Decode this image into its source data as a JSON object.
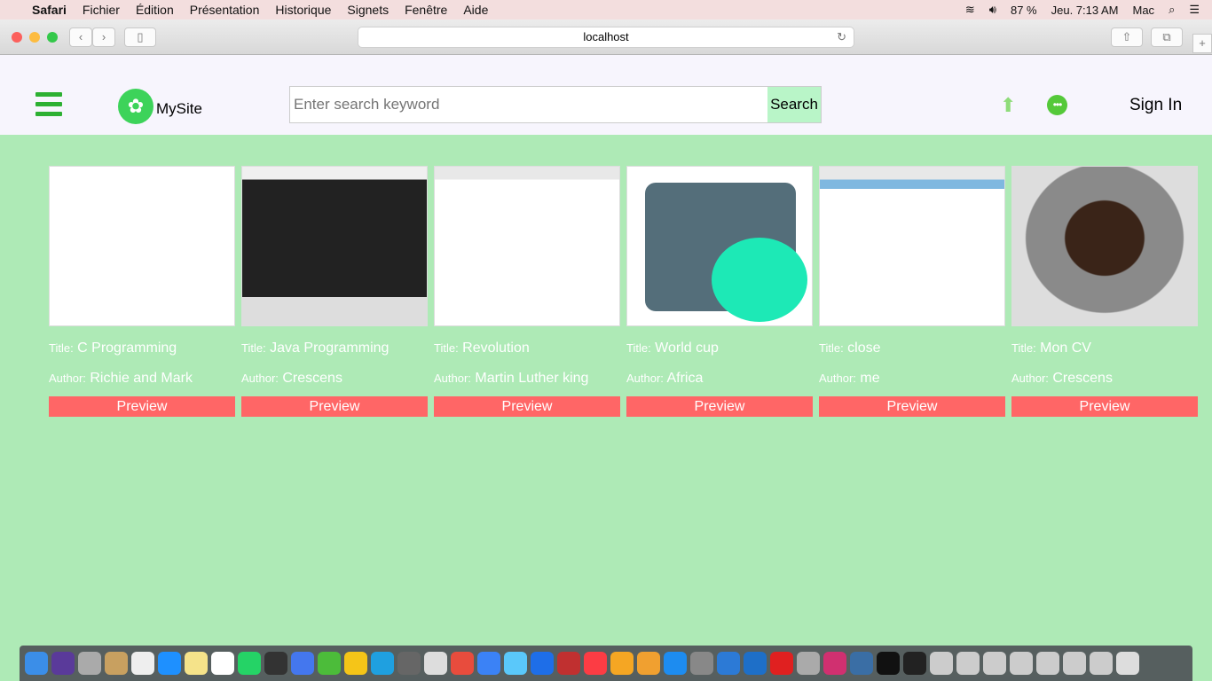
{
  "menubar": {
    "app": "Safari",
    "items": [
      "Fichier",
      "Édition",
      "Présentation",
      "Historique",
      "Signets",
      "Fenêtre",
      "Aide"
    ],
    "battery": "87 %",
    "clock": "Jeu. 7:13 AM",
    "user": "Mac"
  },
  "browser": {
    "url": "localhost"
  },
  "header": {
    "site_name": "MySite",
    "search_placeholder": "Enter search keyword",
    "search_button": "Search",
    "sign_in": "Sign In"
  },
  "labels": {
    "title": "Title:",
    "author": "Author:",
    "preview": "Preview"
  },
  "cards": [
    {
      "title": "C Programming",
      "author": "Richie and Mark"
    },
    {
      "title": "Java Programming",
      "author": "Crescens"
    },
    {
      "title": "Revolution",
      "author": "Martin Luther king"
    },
    {
      "title": "World cup",
      "author": "Africa"
    },
    {
      "title": "close",
      "author": "me"
    },
    {
      "title": "Mon CV",
      "author": "Crescens"
    }
  ],
  "colors": {
    "accent": "#2db032",
    "content_bg": "#aeeab6",
    "preview": "#ff6666"
  }
}
